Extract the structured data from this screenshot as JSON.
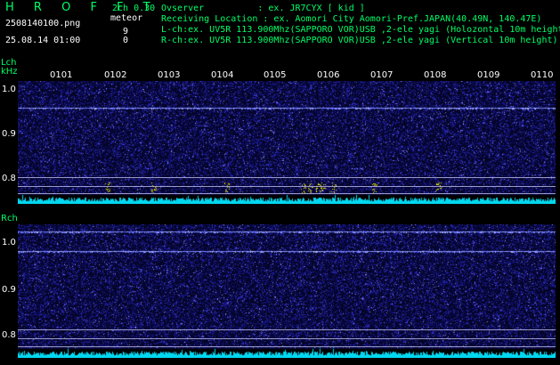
{
  "header": {
    "brand": "H R O F F T",
    "version": "2ch 0.30",
    "filename": "2508140100.png",
    "meteor_label": "meteor",
    "datetime": "25.08.14 01:00",
    "lch_count": "9",
    "rch_count": "0",
    "observer_line": "Ovserver          : ex. JR7CYX [ kid ]",
    "location_line": "Receiving Location : ex. Aomori City Aomori-Pref.JAPAN(40.49N, 140.47E)",
    "lch_line": "L-ch:ex. UV5R 113.900Mhz(SAPPORO VOR)USB ,2-ele yagi (Holozontal 10m height)",
    "rch_line": "R-ch:ex. UV5R 113.900Mhz(SAPPORO VOR)USB ,2-ele yagi (Vertical 10m height)"
  },
  "time_axis": {
    "ticks": [
      "0101",
      "0102",
      "0103",
      "0104",
      "0105",
      "0106",
      "0107",
      "0108",
      "0109",
      "0110"
    ]
  },
  "panels": [
    {
      "id": "lch",
      "label": "Lch",
      "unit": "kHz",
      "freq_labels": [
        "1.0",
        "0.9",
        "0.8"
      ]
    },
    {
      "id": "rch",
      "label": "Rch",
      "unit": "",
      "freq_labels": [
        "1.0",
        "0.9",
        "0.8"
      ]
    }
  ],
  "colors": {
    "label_green": "#00ff66",
    "background": "#000000",
    "noise_blue": "#2a2aa8",
    "carrier": "#8fa0ff",
    "meteor": "#ffff00",
    "baseline": "#00e5ff"
  }
}
